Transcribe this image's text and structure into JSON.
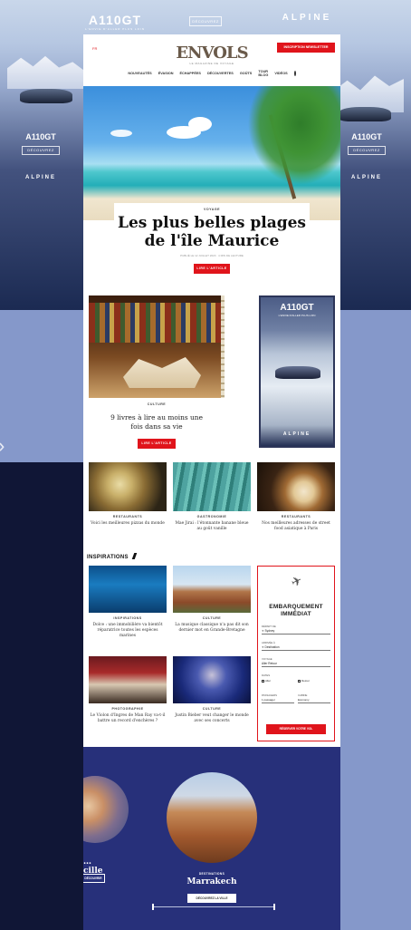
{
  "ad": {
    "model": "A110GT",
    "tagline": "L'ENVIE D'ALLER PLUS LOIN",
    "button": "DÉCOUVREZ",
    "brand": "ALPINE"
  },
  "header": {
    "lang": "FR",
    "logo": "ENVOLS",
    "logo_sub": "LE MAGAZINE DE VOYAGE",
    "subscribe": "INSCRIPTION NEWSLETTER",
    "nav": [
      "NOUVEAUTÉS",
      "ÉVASION",
      "ÉCHAPPÉES",
      "DÉCOUVERTES",
      "GOÛTS",
      "TOUR BLOG",
      "VIDÉOS"
    ]
  },
  "hero": {
    "kicker": "VOYAGE",
    "title": "Les plus belles plages de l'île Maurice",
    "meta": "PUBLIÉ LE 12 JUILLET 2023 · 4 MIN DE LECTURE",
    "button": "LIRE L'ARTICLE"
  },
  "culture_feature": {
    "kicker": "CULTURE",
    "title": "9 livres à lire au moins une fois dans sa vie",
    "button": "LIRE L'ARTICLE"
  },
  "row_articles": [
    {
      "kicker": "RESTAURANTS",
      "title": "Voici les meilleures pizzas du monde"
    },
    {
      "kicker": "GASTRONOMIE",
      "title": "Mae Jirai : l'étonnante banane bleue au goût vanille"
    },
    {
      "kicker": "RESTAURANTS",
      "title": "Nos meilleures adresses de street food asiatique à Paris"
    }
  ],
  "inspirations": {
    "heading": "INSPIRATIONS",
    "items": [
      {
        "kicker": "INSPIRATIONS",
        "title": "Dolce : une immobilière va bientôt réparatrice toutes les espèces marines"
      },
      {
        "kicker": "CULTURE",
        "title": "La musique classique n'a pas dit son dernier mot en Grande-Bretagne"
      },
      {
        "kicker": "PHOTOGRAPHIE",
        "title": "Le Violon d'Ingres de Man Ray va-t-il battre un record d'enchères ?"
      },
      {
        "kicker": "CULTURE",
        "title": "Justin Bieber veut changer le monde avec ses concerts"
      }
    ]
  },
  "booking": {
    "title": "EMBARQUEMENT IMMÉDIAT",
    "depart_label": "DÉPART DE",
    "depart_value": "✈ Sydney",
    "arrival_label": "ARRIVÉE À",
    "arrival_value": "✈ Destination",
    "travel_label": "VOYAGE",
    "travel_value": "Aller Retour",
    "dates_label": "DATES",
    "date_out": "Aller",
    "date_back": "Retour",
    "passengers_label": "PASSAGERS",
    "passengers_value": "1 passager",
    "cabin_label": "CABINE",
    "cabin_value": "Economy",
    "button": "RÉSERVER VOTRE VOL"
  },
  "destinations": [
    {
      "name": "…cille",
      "button": "DÉCOUVRIR"
    },
    {
      "kicker": "DESTINATIONS",
      "name": "Marrakech",
      "button": "DÉCOUVREZ LA VILLE"
    }
  ]
}
